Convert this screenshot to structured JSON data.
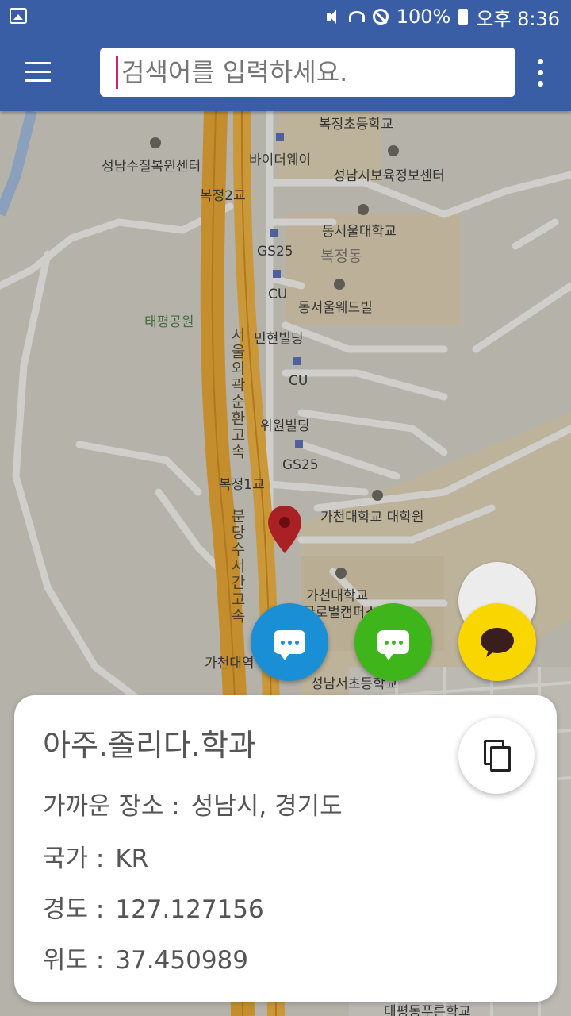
{
  "status_bar": {
    "battery": "100%",
    "time": "오후 8:36",
    "icons": [
      "gallery-icon",
      "mute-icon",
      "wifi-icon",
      "no-disturb-icon",
      "battery-icon"
    ]
  },
  "app_bar": {
    "search_placeholder": "검색어를 입력하세요.",
    "menu_icon": "hamburger-menu-icon",
    "overflow_icon": "more-vert-icon",
    "colors": {
      "bar": "#3a5ea6",
      "cursor": "#d0216e"
    }
  },
  "map": {
    "labels": [
      "복정초등학교",
      "성남수질복원센터",
      "바이더웨이",
      "성남시보육정보센터",
      "복정2교",
      "동서울대학교",
      "GS25",
      "복정동",
      "CU",
      "동서울웨드빌",
      "태평공원",
      "민현빌딩",
      "CU",
      "서울외곽순환고속",
      "위원빌딩",
      "GS25",
      "복정1교",
      "가천대학교 대학원",
      "분당수서간고속",
      "가천대학교",
      "글로벌캠퍼스",
      "가천대역",
      "성남서초등학교",
      "태평동푸른학교"
    ],
    "pin_icon": "location-pin-icon"
  },
  "share_buttons": [
    {
      "name": "sms-share-button",
      "color": "#1a8fd6"
    },
    {
      "name": "line-share-button",
      "color": "#3eb51a"
    },
    {
      "name": "kakaotalk-share-button",
      "color": "#fad600"
    }
  ],
  "info_card": {
    "title": "아주.졸리다.학과",
    "near_label": "가까운 장소 :",
    "near_value": "성남시, 경기도",
    "country_label": "국가 :",
    "country_value": "KR",
    "longitude_label": "경도 :",
    "longitude_value": "127.127156",
    "latitude_label": "위도 :",
    "latitude_value": "37.450989",
    "copy_icon": "copy-icon"
  }
}
